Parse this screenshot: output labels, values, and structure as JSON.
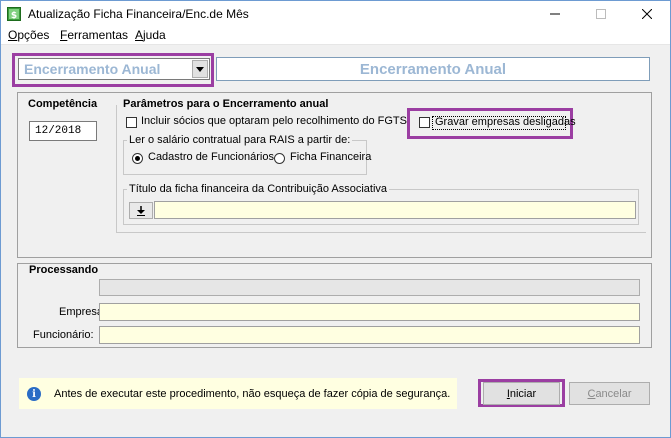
{
  "window": {
    "title": "Atualização Ficha Financeira/Enc.de Mês",
    "minimize_icon": "minimize-icon",
    "maximize_icon": "maximize-icon",
    "close_icon": "close-icon"
  },
  "menu": {
    "opcoes": {
      "accel": "O",
      "rest": "pções"
    },
    "ferramentas": {
      "accel": "F",
      "rest": "erramentas"
    },
    "ajuda": {
      "accel": "A",
      "rest": "juda"
    }
  },
  "process_select": {
    "value": "Encerramento Anual"
  },
  "header": {
    "title": "Encerramento Anual"
  },
  "competencia": {
    "label": "Competência",
    "value": "12/2018"
  },
  "parametros": {
    "label": "Parâmetros para o Encerramento anual",
    "incluir_socios": {
      "label": "Incluir sócios que optaram pelo recolhimento do FGTS",
      "checked": false
    },
    "gravar_empresas": {
      "label": "Gravar empresas desligadas",
      "checked": false
    },
    "rais": {
      "label": "Ler o salário contratual para RAIS a partir de:",
      "options": [
        {
          "label": "Cadastro de Funcionários",
          "checked": true
        },
        {
          "label": "Ficha Financeira",
          "checked": false
        }
      ]
    },
    "titulo_ficha": {
      "label": "Título da ficha financeira da Contribuição Associativa",
      "value": "",
      "button_icon": "download-arrow-icon"
    }
  },
  "processando": {
    "label": "Processando",
    "progress": 0,
    "empresa": {
      "label": "Empresa:",
      "value": ""
    },
    "funcionario": {
      "label": "Funcionário:",
      "value": ""
    }
  },
  "info": {
    "icon": "info-icon",
    "text": "Antes de executar este procedimento, não esqueça de fazer cópia de segurança."
  },
  "buttons": {
    "iniciar": {
      "accel": "I",
      "rest": "niciar"
    },
    "cancelar": {
      "accel": "C",
      "rest": "ancelar"
    }
  },
  "colors": {
    "highlight": "#9b3ea2",
    "input_yellow": "#ffffe1",
    "header_text": "#9cb7d4"
  }
}
